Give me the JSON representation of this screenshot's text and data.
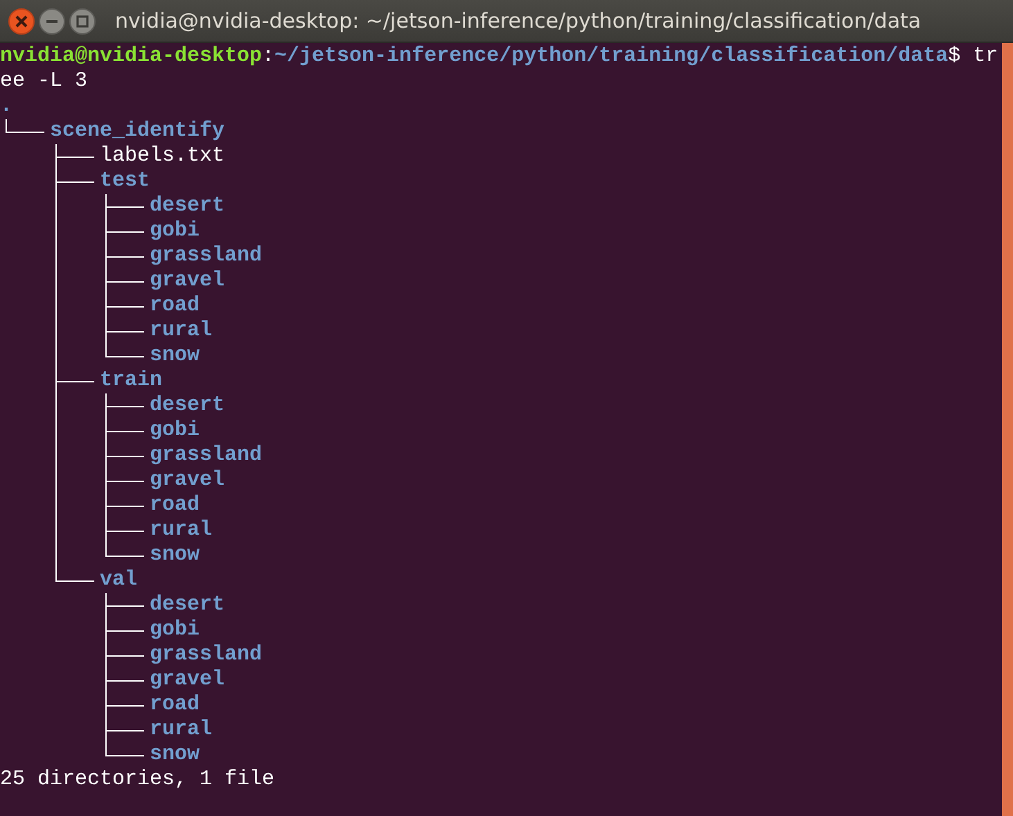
{
  "window": {
    "title": "nvidia@nvidia-desktop: ~/jetson-inference/python/training/classification/data"
  },
  "terminal": {
    "prompt": {
      "user_host": "nvidia@nvidia-desktop",
      "separator": ":",
      "path": "~/jetson-inference/python/training/classification/data",
      "symbol": "$",
      "command_lines": [
        "tr",
        "ee -L 3"
      ]
    },
    "tree": {
      "name": ".",
      "kind": "dir_plain",
      "children": [
        {
          "name": "scene_identify",
          "kind": "dir",
          "children": [
            {
              "name": "labels.txt",
              "kind": "file"
            },
            {
              "name": "test",
              "kind": "dir",
              "children": [
                {
                  "name": "desert",
                  "kind": "dir"
                },
                {
                  "name": "gobi",
                  "kind": "dir"
                },
                {
                  "name": "grassland",
                  "kind": "dir"
                },
                {
                  "name": "gravel",
                  "kind": "dir"
                },
                {
                  "name": "road",
                  "kind": "dir"
                },
                {
                  "name": "rural",
                  "kind": "dir"
                },
                {
                  "name": "snow",
                  "kind": "dir"
                }
              ]
            },
            {
              "name": "train",
              "kind": "dir",
              "children": [
                {
                  "name": "desert",
                  "kind": "dir"
                },
                {
                  "name": "gobi",
                  "kind": "dir"
                },
                {
                  "name": "grassland",
                  "kind": "dir"
                },
                {
                  "name": "gravel",
                  "kind": "dir"
                },
                {
                  "name": "road",
                  "kind": "dir"
                },
                {
                  "name": "rural",
                  "kind": "dir"
                },
                {
                  "name": "snow",
                  "kind": "dir"
                }
              ]
            },
            {
              "name": "val",
              "kind": "dir",
              "children": [
                {
                  "name": "desert",
                  "kind": "dir"
                },
                {
                  "name": "gobi",
                  "kind": "dir"
                },
                {
                  "name": "grassland",
                  "kind": "dir"
                },
                {
                  "name": "gravel",
                  "kind": "dir"
                },
                {
                  "name": "road",
                  "kind": "dir"
                },
                {
                  "name": "rural",
                  "kind": "dir"
                },
                {
                  "name": "snow",
                  "kind": "dir"
                }
              ]
            }
          ]
        }
      ]
    },
    "summary": "25 directories, 1 file"
  }
}
